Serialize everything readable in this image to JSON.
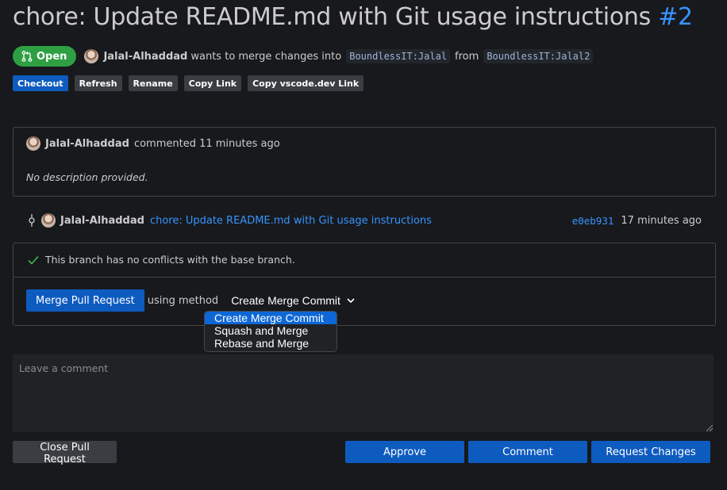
{
  "pr": {
    "title": "chore: Update README.md with Git usage instructions",
    "number": "#2",
    "status": "Open",
    "author": "Jalal-Alhaddad",
    "merge_text": "wants to merge changes into",
    "target_branch": "BoundlessIT:Jalal",
    "from_text": "from",
    "source_branch": "BoundlessIT:Jalal2"
  },
  "actions": {
    "checkout": "Checkout",
    "refresh": "Refresh",
    "rename": "Rename",
    "copy_link": "Copy Link",
    "copy_vscode_link": "Copy vscode.dev Link"
  },
  "comment": {
    "author": "Jalal-Alhaddad",
    "meta": "commented 11 minutes ago",
    "body": "No description provided."
  },
  "commit": {
    "author": "Jalal-Alhaddad",
    "message": "chore: Update README.md with Git usage instructions",
    "sha": "e0eb931",
    "time": "17 minutes ago"
  },
  "merge": {
    "status_text": "This branch has no conflicts with the base branch.",
    "button_label": "Merge Pull Request",
    "using_method": "using method",
    "selected_method": "Create Merge Commit",
    "options": [
      "Create Merge Commit",
      "Squash and Merge",
      "Rebase and Merge"
    ]
  },
  "new_comment": {
    "placeholder": "Leave a comment"
  },
  "footer": {
    "close": "Close Pull Request",
    "approve": "Approve",
    "comment": "Comment",
    "request_changes": "Request Changes"
  },
  "colors": {
    "background": "#17191c",
    "accent_blue": "#0e5bc0",
    "link_blue": "#3794ff",
    "open_green": "#2ea043",
    "check_green": "#3fb950",
    "selected_option": "#0d67d6"
  },
  "icons": {
    "status": "git-pull-request-icon",
    "commit": "git-commit-icon",
    "check": "check-icon",
    "dropdown": "chevron-down-icon"
  }
}
